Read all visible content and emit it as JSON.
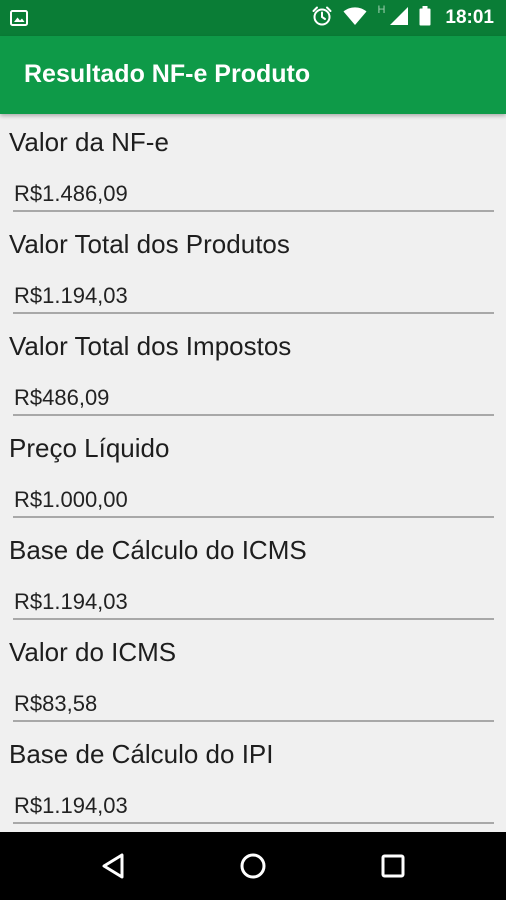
{
  "status_bar": {
    "time": "18:01",
    "network_type": "H",
    "icons": [
      "image-icon",
      "alarm-icon",
      "wifi-icon",
      "signal-icon",
      "battery-icon"
    ]
  },
  "app_bar": {
    "title": "Resultado NF-e Produto",
    "color": "#0e9a48"
  },
  "fields": [
    {
      "label": "Valor da NF-e",
      "value": "R$1.486,09"
    },
    {
      "label": "Valor Total dos Produtos",
      "value": "R$1.194,03"
    },
    {
      "label": "Valor Total dos Impostos",
      "value": "R$486,09"
    },
    {
      "label": "Preço Líquido",
      "value": "R$1.000,00"
    },
    {
      "label": "Base de Cálculo do ICMS",
      "value": "R$1.194,03"
    },
    {
      "label": "Valor do ICMS",
      "value": "R$83,58"
    },
    {
      "label": "Base de Cálculo do IPI",
      "value": "R$1.194,03"
    }
  ],
  "nav_bar": {
    "buttons": [
      "back-icon",
      "home-icon",
      "recents-icon"
    ]
  }
}
